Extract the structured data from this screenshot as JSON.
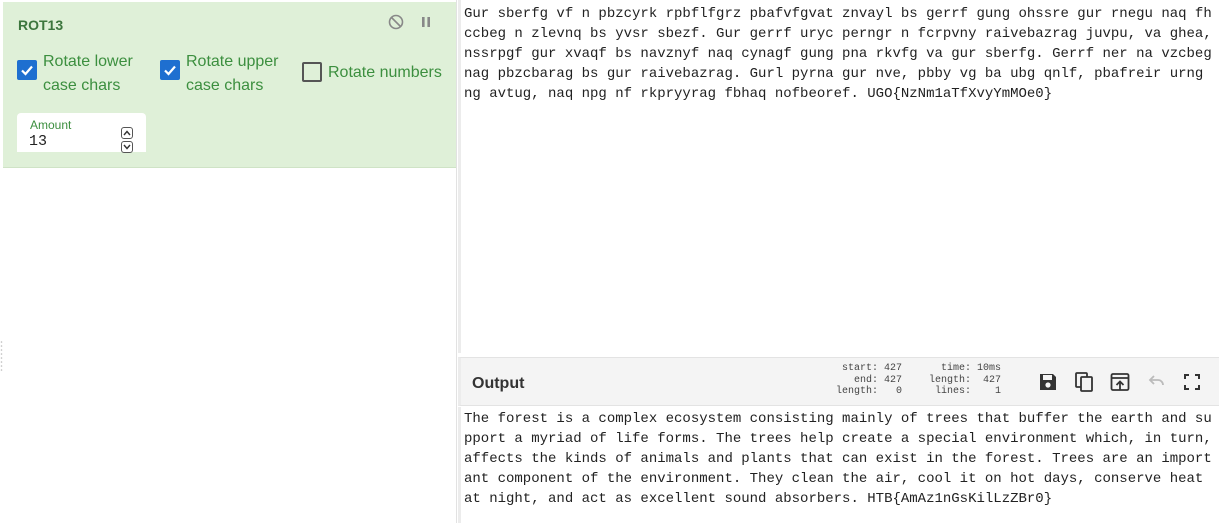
{
  "colors": {
    "op_bg": "#dff0d8",
    "op_text": "#3c763d",
    "checkbox_accent": "#1e6fd0"
  },
  "operation": {
    "title": "ROT13",
    "icons": [
      "disable-icon",
      "pause-icon"
    ],
    "options": {
      "lower": {
        "label": "Rotate lower case chars",
        "checked": true
      },
      "upper": {
        "label": "Rotate upper case chars",
        "checked": true
      },
      "numbers": {
        "label": "Rotate numbers",
        "checked": false
      }
    },
    "amount": {
      "label": "Amount",
      "value": "13"
    }
  },
  "input": {
    "text": "Gur sberfg vf n pbzcyrk rpbflfgrz pbafvfgvat znvayl bs gerrf gung ohssre gur rnegu naq fhccbeg n zlevnq bs yvsr sbezf. Gur gerrf uryc perngr n fcrpvny raivebazrag juvpu, va ghea, nssrpgf gur xvaqf bs navznyf naq cynagf gung pna rkvfg va gur sberfg. Gerrf ner na vzcbegnag pbzcbarag bs gur raivebazrag. Gurl pyrna gur nve, pbby vg ba ubg qnlf, pbafreir urng ng avtug, naq npg nf rkpryyrag fbhaq nofbeoref. UGO{NzNm1aTfXvyYmMOe0}"
  },
  "output": {
    "title": "Output",
    "stats": {
      "start": "start: 427",
      "end": "end: 427",
      "length": "length:   0",
      "time": "time: 10ms",
      "length2": "length:  427",
      "lines": "lines:    1"
    },
    "tools": [
      "save-icon",
      "copy-icon",
      "replace-input-icon",
      "undo-icon",
      "maximise-icon"
    ],
    "text": "The forest is a complex ecosystem consisting mainly of trees that buffer the earth and support a myriad of life forms. The trees help create a special environment which, in turn, affects the kinds of animals and plants that can exist in the forest. Trees are an important component of the environment. They clean the air, cool it on hot days, conserve heat at night, and act as excellent sound absorbers. HTB{AmAz1nGsKilLzZBr0}"
  }
}
